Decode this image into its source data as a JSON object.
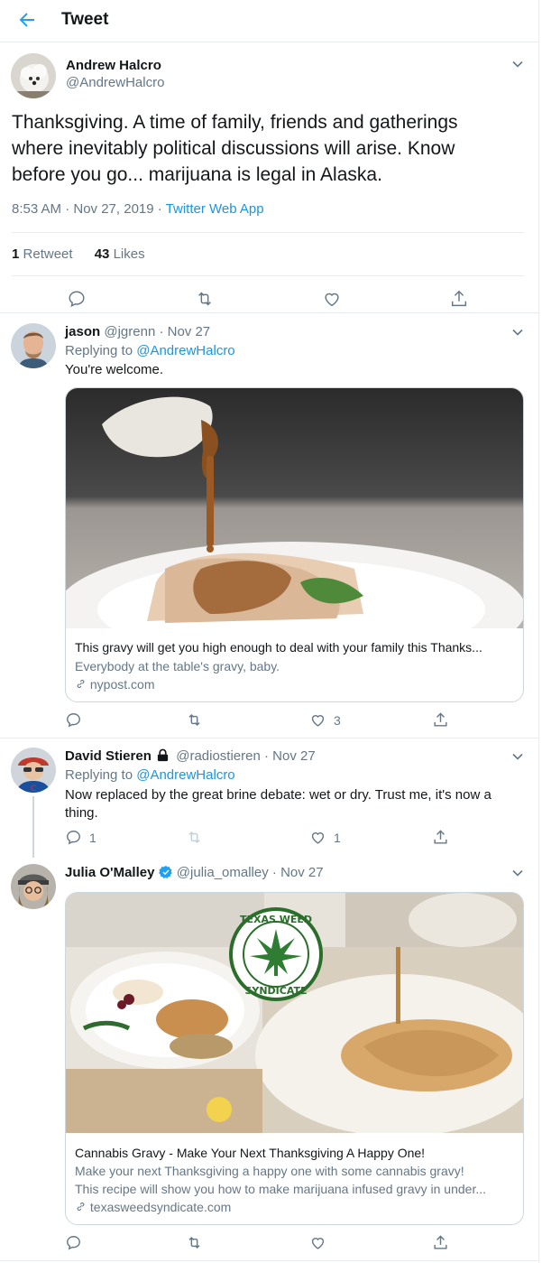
{
  "header": {
    "title": "Tweet"
  },
  "main_tweet": {
    "author_name": "Andrew Halcro",
    "author_handle": "@AndrewHalcro",
    "text_line1": "Thanksgiving. A time of family, friends and gatherings",
    "text_line2": "where inevitably political discussions will arise. Know",
    "text_line3": "before you go... marijuana is legal in Alaska.",
    "timestamp": "8:53 AM · Nov 27, 2019 · ",
    "source": "Twitter Web App",
    "retweets_count": "1",
    "retweets_label": "Retweet",
    "likes_count": "43",
    "likes_label": "Likes"
  },
  "replies": [
    {
      "author_name": "jason",
      "author_meta": "@jgrenn · Nov 27",
      "replying_prefix": "Replying to ",
      "replying_handle": "@AndrewHalcro",
      "text": "You're welcome.",
      "card": {
        "title": "This gravy will get you high enough to deal with your family this Thanks...",
        "description": "Everybody at the table's gravy, baby.",
        "domain": "nypost.com"
      },
      "reply_count": "",
      "retweet_count": "",
      "like_count": "3"
    },
    {
      "author_name": "David Stieren",
      "author_meta": "@radiostieren · Nov 27",
      "replying_prefix": "Replying to ",
      "replying_handle": "@AndrewHalcro",
      "text_line1": "Now replaced by the great brine debate: wet or dry. Trust me, it's now a",
      "text_line2": "thing.",
      "reply_count": "1",
      "like_count": "1"
    },
    {
      "author_name": "Julia O'Malley",
      "author_meta": "@julia_omalley · Nov 27",
      "card": {
        "logo_text_top": "TEXAS WEED",
        "logo_text_bottom": "SYNDICATE",
        "title": "Cannabis Gravy - Make Your Next Thanksgiving A Happy One!",
        "description_line1": "Make your next Thanksgiving a happy one with some cannabis gravy!",
        "description_line2": "This recipe will show you how to make marijuana infused gravy in under...",
        "domain": "texasweedsyndicate.com"
      }
    }
  ],
  "colors": {
    "accent": "#1da1f2",
    "link": "#1b95e0",
    "muted": "#657786",
    "border": "#e6ecf0",
    "verified": "#1da1f2"
  },
  "icons": [
    "back-arrow-icon",
    "chevron-down-icon",
    "reply-icon",
    "retweet-icon",
    "like-icon",
    "share-icon",
    "link-icon",
    "lock-icon",
    "verified-icon"
  ]
}
